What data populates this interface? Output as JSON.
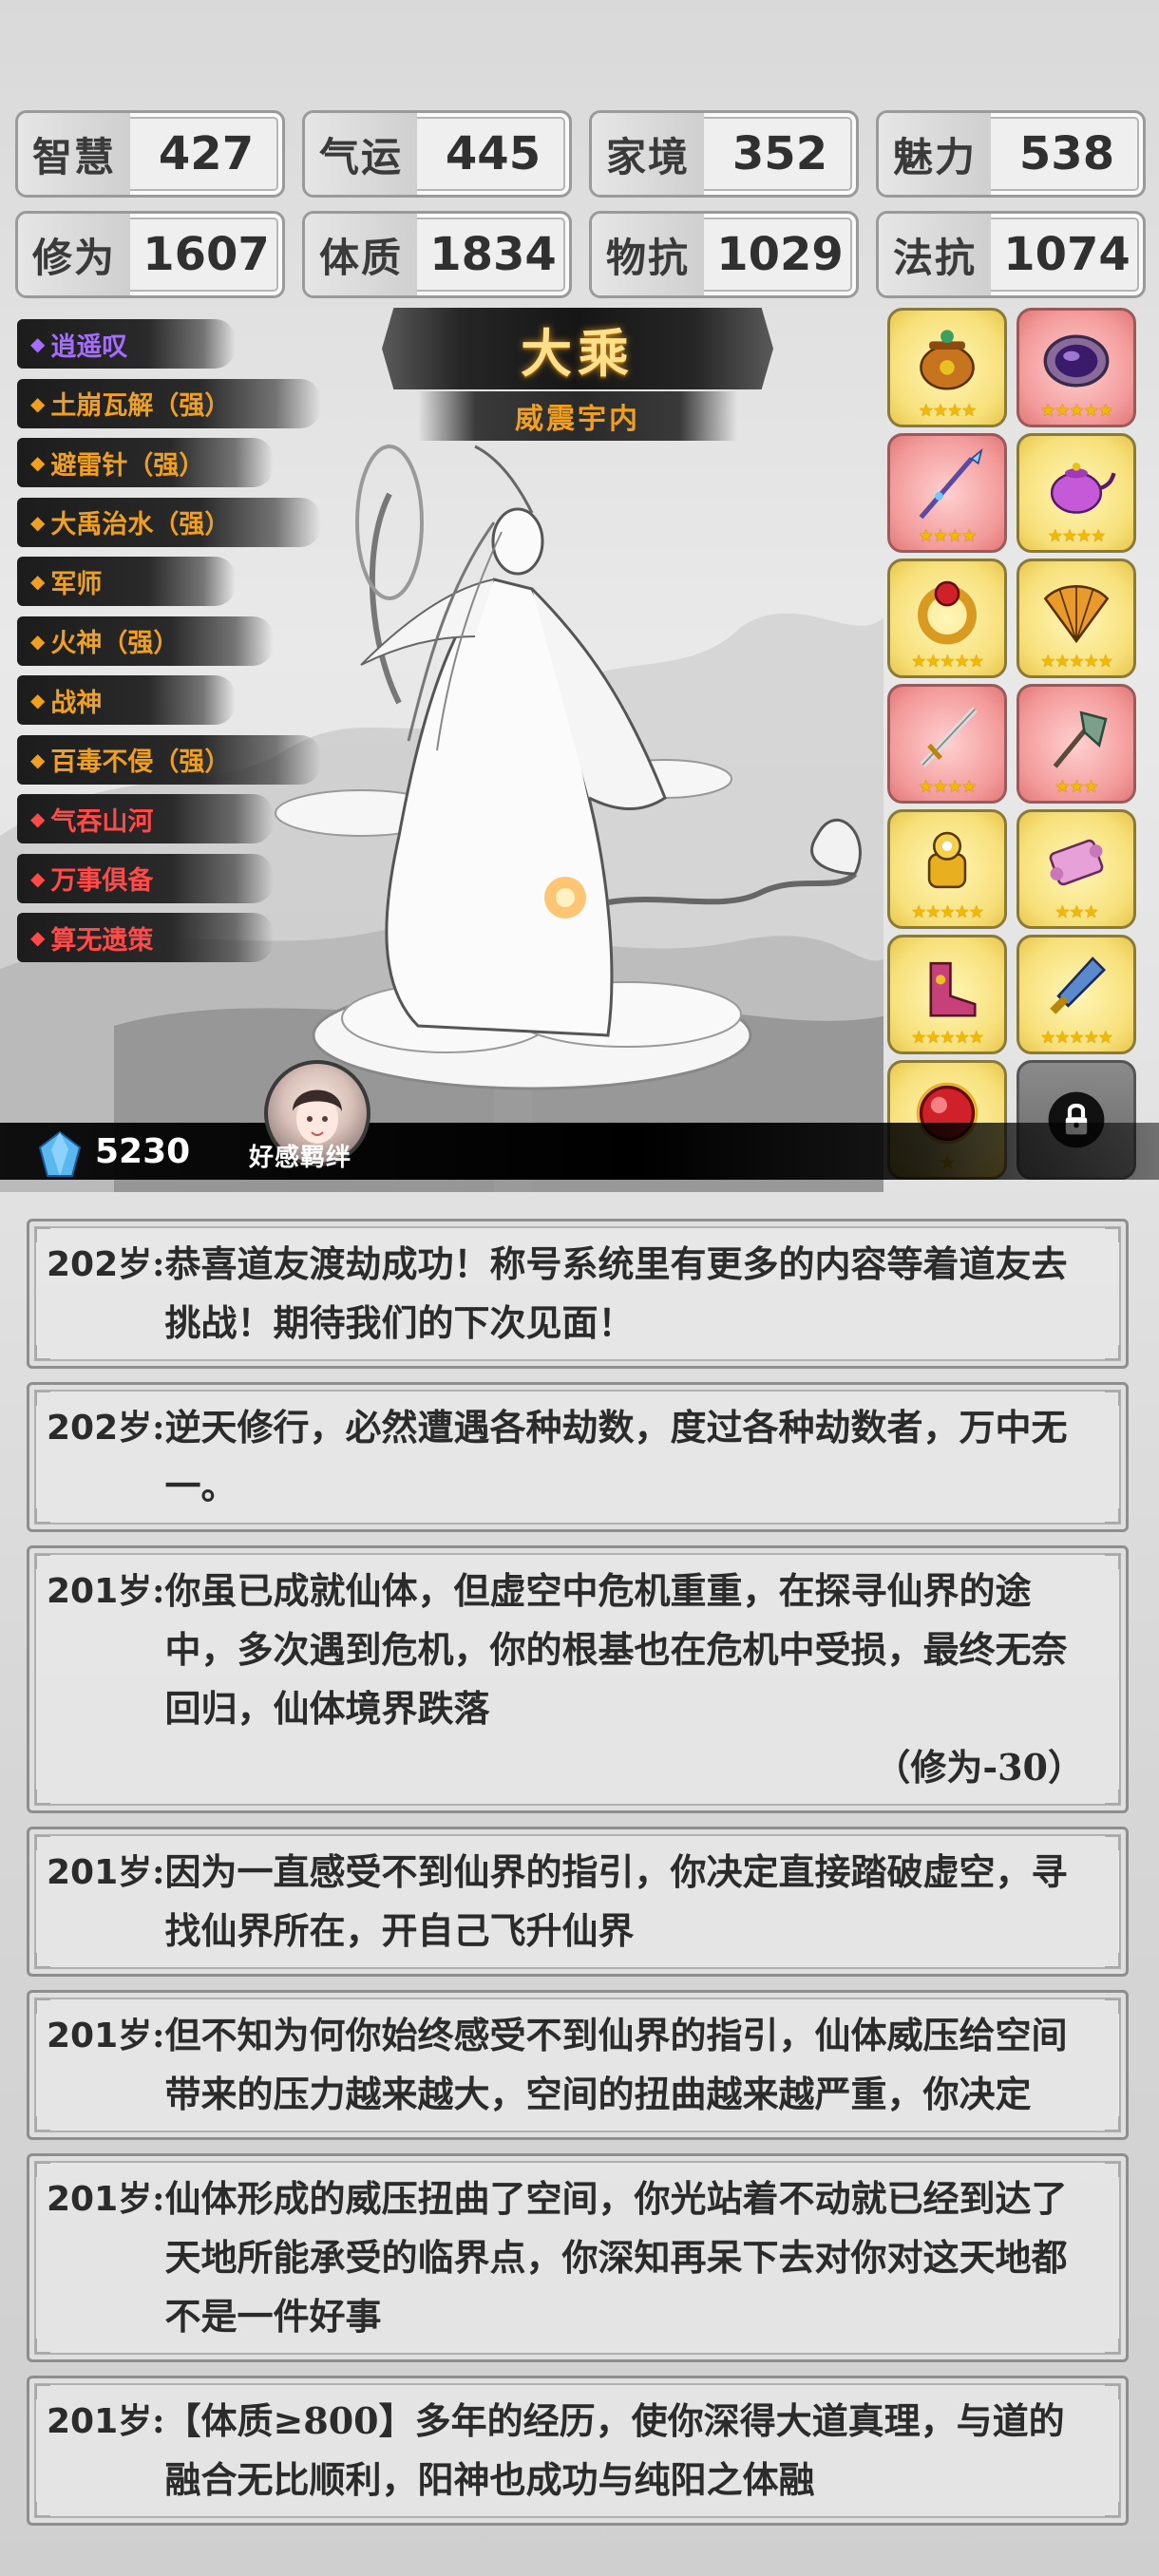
{
  "stats": [
    {
      "name": "智慧",
      "value": "427"
    },
    {
      "name": "气运",
      "value": "445"
    },
    {
      "name": "家境",
      "value": "352"
    },
    {
      "name": "魅力",
      "value": "538"
    },
    {
      "name": "修为",
      "value": "1607"
    },
    {
      "name": "体质",
      "value": "1834"
    },
    {
      "name": "物抗",
      "value": "1029"
    },
    {
      "name": "法抗",
      "value": "1074"
    }
  ],
  "realm": {
    "title": "大乘",
    "subtitle": "威震宇内"
  },
  "traits": [
    {
      "label": "逍遥叹",
      "color": "purple"
    },
    {
      "label": "土崩瓦解（强）",
      "color": "orange"
    },
    {
      "label": "避雷针（强）",
      "color": "orange"
    },
    {
      "label": "大禹治水（强）",
      "color": "orange"
    },
    {
      "label": "军师",
      "color": "orange"
    },
    {
      "label": "火神（强）",
      "color": "orange"
    },
    {
      "label": "战神",
      "color": "orange"
    },
    {
      "label": "百毒不侵（强）",
      "color": "orange"
    },
    {
      "label": "气吞山河",
      "color": "red"
    },
    {
      "label": "万事俱备",
      "color": "red"
    },
    {
      "label": "算无遗策",
      "color": "red"
    }
  ],
  "equipment": [
    {
      "icon": "cauldron-icon",
      "rarity": "gold",
      "stars": "★★★★"
    },
    {
      "icon": "mirror-icon",
      "rarity": "pink",
      "stars": "★★★★★"
    },
    {
      "icon": "spear-icon",
      "rarity": "pink",
      "stars": "★★★★"
    },
    {
      "icon": "teapot-icon",
      "rarity": "gold",
      "stars": "★★★★"
    },
    {
      "icon": "ring-icon",
      "rarity": "gold",
      "stars": "★★★★★"
    },
    {
      "icon": "fan-icon",
      "rarity": "gold",
      "stars": "★★★★★"
    },
    {
      "icon": "sword-icon",
      "rarity": "pink",
      "stars": "★★★★"
    },
    {
      "icon": "axe-icon",
      "rarity": "pink",
      "stars": "★★★"
    },
    {
      "icon": "gauntlet-icon",
      "rarity": "gold",
      "stars": "★★★★★"
    },
    {
      "icon": "scroll-icon",
      "rarity": "gold",
      "stars": "★★★"
    },
    {
      "icon": "boots-icon",
      "rarity": "gold",
      "stars": "★★★★★"
    },
    {
      "icon": "dagger-icon",
      "rarity": "gold",
      "stars": "★★★★★"
    },
    {
      "icon": "orb-icon",
      "rarity": "gold",
      "stars": "★"
    },
    {
      "icon": "lock-icon",
      "rarity": "locked",
      "stars": ""
    }
  ],
  "currency": {
    "icon": "gem-icon",
    "amount": "5230"
  },
  "bond": {
    "label": "好感羁绊"
  },
  "log": [
    {
      "age": "202",
      "suffix": "岁:",
      "text": "恭喜道友渡劫成功！称号系统里有更多的内容等着道友去挑战！期待我们的下次见面！",
      "extra": ""
    },
    {
      "age": "202",
      "suffix": "岁:",
      "text": "逆天修行，必然遭遇各种劫数，度过各种劫数者，万中无一。",
      "extra": ""
    },
    {
      "age": "201",
      "suffix": "岁:",
      "text": "你虽已成就仙体，但虚空中危机重重，在探寻仙界的途中，多次遇到危机，你的根基也在危机中受损，最终无奈回归，仙体境界跌落",
      "extra": "（修为-30）"
    },
    {
      "age": "201",
      "suffix": "岁:",
      "text": "因为一直感受不到仙界的指引，你决定直接踏破虚空，寻找仙界所在，开自己飞升仙界",
      "extra": ""
    },
    {
      "age": "201",
      "suffix": "岁:",
      "text": "但不知为何你始终感受不到仙界的指引，仙体威压给空间带来的压力越来越大，空间的扭曲越来越严重，你决定",
      "extra": ""
    },
    {
      "age": "201",
      "suffix": "岁:",
      "text": "仙体形成的威压扭曲了空间，你光站着不动就已经到达了天地所能承受的临界点，你深知再呆下去对你对这天地都不是一件好事",
      "extra": ""
    },
    {
      "age": "201",
      "suffix": "岁:",
      "text": "【体质≥800】多年的经历，使你深得大道真理，与道的融合无比顺利，阳神也成功与纯阳之体融",
      "extra": ""
    }
  ]
}
